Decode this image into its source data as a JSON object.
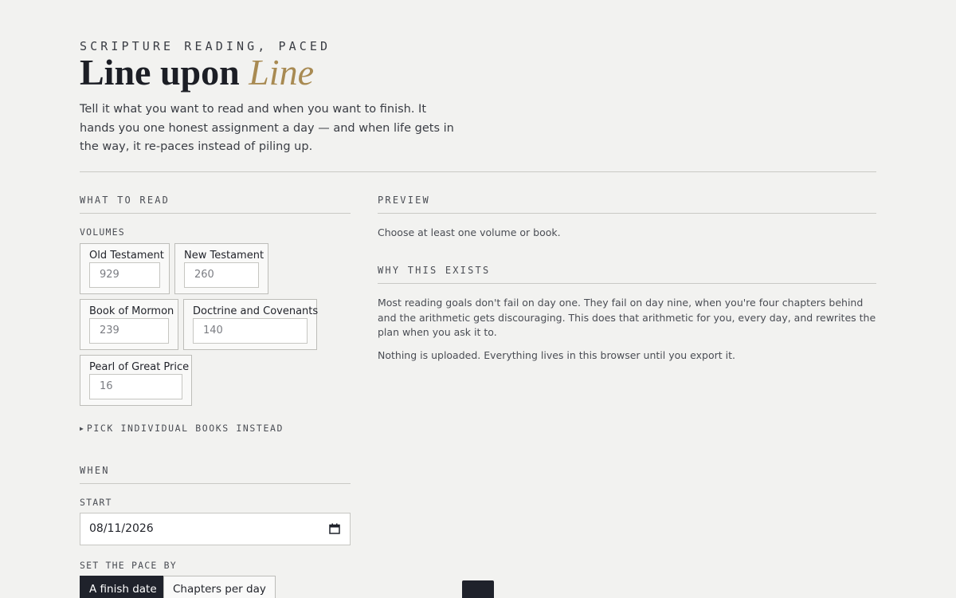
{
  "header": {
    "eyebrow": "SCRIPTURE READING, PACED",
    "title_main": "Line upon ",
    "title_accent": "Line",
    "lede": "Tell it what you want to read and when you want to finish. It hands you one honest assignment a day — and when life gets in the way, it re-paces instead of piling up."
  },
  "what_to_read": {
    "heading": "WHAT TO READ",
    "volumes_label": "VOLUMES",
    "volumes": [
      {
        "name": "Old Testament",
        "chapters": "929"
      },
      {
        "name": "New Testament",
        "chapters": "260"
      },
      {
        "name": "Book of Mormon",
        "chapters": "239"
      },
      {
        "name": "Doctrine and Covenants",
        "chapters": "140"
      },
      {
        "name": "Pearl of Great Price",
        "chapters": "16"
      }
    ],
    "pick_books_label": "PICK INDIVIDUAL BOOKS INSTEAD"
  },
  "when": {
    "heading": "WHEN",
    "start_label": "START",
    "start_value": "08/11/2026",
    "pace_label": "SET THE PACE BY",
    "pace_options": [
      "A finish date",
      "Chapters per day"
    ],
    "pace_selected": "A finish date"
  },
  "preview": {
    "heading": "PREVIEW",
    "empty_message": "Choose at least one volume or book."
  },
  "why": {
    "heading": "WHY THIS EXISTS",
    "paragraphs": [
      "Most reading goals don't fail on day one. They fail on day nine, when you're four chapters behind and the arithmetic gets discouraging. This does that arithmetic for you, every day, and rewrites the plan when you ask it to.",
      "Nothing is uploaded. Everything lives in this browser until you export it."
    ]
  },
  "colors": {
    "background": "#f2f2f0",
    "accent": "#a88a52",
    "ink": "#1f222b"
  }
}
